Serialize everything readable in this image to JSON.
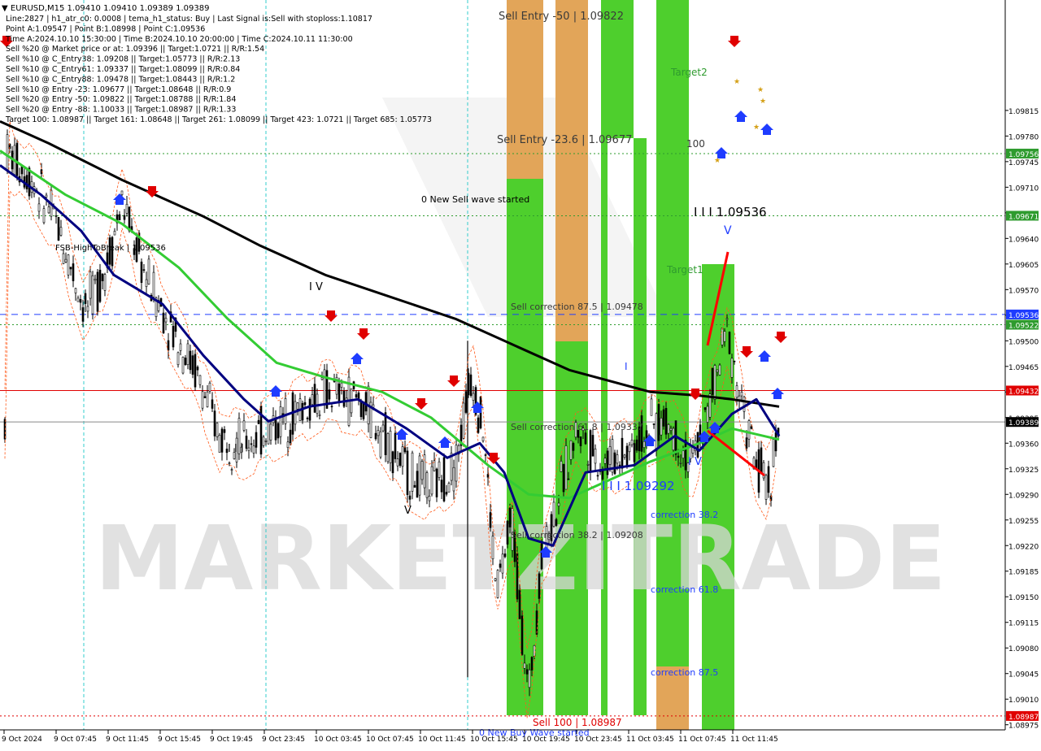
{
  "chart_data": {
    "type": "candlestick",
    "symbol_header": "EURUSD,M15  1.09410 1.09410 1.09389 1.09389",
    "info_lines": [
      "Line:2827 | h1_atr_c0: 0.0008 | tema_h1_status: Buy | Last Signal is:Sell with stoploss:1.10817",
      "Point A:1.09547 | Point B:1.08998 | Point C:1.09536",
      "Time A:2024.10.10 15:30:00 | Time B:2024.10.10 20:00:00 | Time C:2024.10.11 11:30:00",
      "Sell %20 @ Market price or at: 1.09396 || Target:1.0721 || R/R:1.54",
      "Sell %10 @ C_Entry38: 1.09208 || Target:1.05773 || R/R:2.13",
      "Sell %10 @ C_Entry61: 1.09337 || Target:1.08099 || R/R:0.84",
      "Sell %10 @ C_Entry88: 1.09478 || Target:1.08443 || R/R:1.2",
      "Sell %10 @ Entry -23: 1.09677 || Target:1.08648 || R/R:0.9",
      "Sell %20 @ Entry -50: 1.09822 || Target:1.08788 || R/R:1.84",
      "Sell %20 @ Entry -88: 1.10033 || Target:1.08987 || R/R:1.33",
      "Target 100: 1.08987 || Target 161: 1.08648 || Target 261: 1.08099 || Target 423: 1.0721 || Target 685: 1.05773"
    ],
    "y_range": [
      1.08968,
      1.09966
    ],
    "y_ticks": [
      "1.09815",
      "1.09780",
      "1.09745",
      "1.09710",
      "1.09675",
      "1.09640",
      "1.09605",
      "1.09570",
      "1.09535",
      "1.09500",
      "1.09465",
      "1.09430",
      "1.09395",
      "1.09360",
      "1.09325",
      "1.09290",
      "1.09255",
      "1.09220",
      "1.09185",
      "1.09150",
      "1.09115",
      "1.09080",
      "1.09045",
      "1.09010",
      "1.08975"
    ],
    "x_ticks": [
      "9 Oct 2024",
      "9 Oct 07:45",
      "9 Oct 11:45",
      "9 Oct 15:45",
      "9 Oct 19:45",
      "9 Oct 23:45",
      "10 Oct 03:45",
      "10 Oct 07:45",
      "10 Oct 11:45",
      "10 Oct 15:45",
      "10 Oct 19:45",
      "10 Oct 23:45",
      "11 Oct 03:45",
      "11 Oct 07:45",
      "11 Oct 11:45"
    ],
    "price_tags": [
      {
        "value": 1.09756,
        "label": "1.09756",
        "color": "#2e9b2e"
      },
      {
        "value": 1.09671,
        "label": "1.09671",
        "color": "#2e9b2e"
      },
      {
        "value": 1.09536,
        "label": "1.09536",
        "color": "#1e3cff"
      },
      {
        "value": 1.09522,
        "label": "1.09522",
        "color": "#2e9b2e"
      },
      {
        "value": 1.09432,
        "label": "1.09432",
        "color": "#e00000"
      },
      {
        "value": 1.09389,
        "label": "1.09389",
        "color": "#000000"
      },
      {
        "value": 1.08987,
        "label": "1.08987",
        "color": "#e00000"
      }
    ],
    "annotations": [
      {
        "text": "Sell Entry -50 | 1.09822",
        "color": "#3a3a3a"
      },
      {
        "text": "Target2",
        "color": "#2e9b2e"
      },
      {
        "text": "Sell Entry -23.6 | 1.09677",
        "color": "#3a3a3a"
      },
      {
        "text": "100",
        "color": "#3a3a3a"
      },
      {
        "text": "0 New Sell wave started",
        "color": "#000000"
      },
      {
        "text": "I I I 1.09536",
        "color": "#000000"
      },
      {
        "text": "FSB-HighToBreak | 1.09536",
        "color": "#000000"
      },
      {
        "text": "Target1",
        "color": "#2e9b2e"
      },
      {
        "text": "V",
        "color": "#1e3cff"
      },
      {
        "text": "I V",
        "color": "#000000"
      },
      {
        "text": "Sell correction 87.5 | 1.09478",
        "color": "#3a3a3a"
      },
      {
        "text": "I",
        "color": "#1e3cff"
      },
      {
        "text": "Sell correction 61.8 | 1.09337",
        "color": "#3a3a3a"
      },
      {
        "text": "I I I",
        "color": "#000000"
      },
      {
        "text": "I V",
        "color": "#1e3cff"
      },
      {
        "text": "V",
        "color": "#000000"
      },
      {
        "text": "I I I 1.09292",
        "color": "#1e3cff"
      },
      {
        "text": "correction 38.2",
        "color": "#1e3cff"
      },
      {
        "text": "Sell correction 38.2 | 1.09208",
        "color": "#3a3a3a"
      },
      {
        "text": "correction 61.8",
        "color": "#1e3cff"
      },
      {
        "text": "correction 87.5",
        "color": "#1e3cff"
      },
      {
        "text": "Sell 100 | 1.08987",
        "color": "#e00000"
      },
      {
        "text": "0 New Buy Wave started",
        "color": "#1e3cff"
      }
    ],
    "horizontal_levels": [
      {
        "value": 1.09756,
        "style": "dotted",
        "color": "#2e9b2e"
      },
      {
        "value": 1.09671,
        "style": "dotted",
        "color": "#2e9b2e"
      },
      {
        "value": 1.09536,
        "style": "dashed",
        "color": "#1e3cff"
      },
      {
        "value": 1.09522,
        "style": "dotted",
        "color": "#2e9b2e"
      },
      {
        "value": 1.09432,
        "style": "solid",
        "color": "#e00000"
      },
      {
        "value": 1.09389,
        "style": "solid",
        "color": "#888888"
      },
      {
        "value": 1.08987,
        "style": "dotted",
        "color": "#e00000"
      }
    ],
    "vertical_markers": [
      "9 Oct 07:45",
      "9 Oct 23:45",
      "10 Oct 15:45"
    ],
    "series": [
      {
        "kind": "ma",
        "color": "#000000",
        "points": [
          [
            0,
            1.098
          ],
          [
            60,
            1.0977
          ],
          [
            150,
            1.0972
          ],
          [
            250,
            1.0967
          ],
          [
            320,
            1.0963
          ],
          [
            400,
            1.0959
          ],
          [
            480,
            1.0956
          ],
          [
            560,
            1.0953
          ],
          [
            620,
            1.095
          ],
          [
            700,
            1.0946
          ],
          [
            800,
            1.0943
          ],
          [
            860,
            1.09425
          ],
          [
            900,
            1.0942
          ],
          [
            958,
            1.0941
          ]
        ]
      },
      {
        "kind": "ma",
        "color": "#33cc33",
        "points": [
          [
            0,
            1.0976
          ],
          [
            80,
            1.097
          ],
          [
            150,
            1.0966
          ],
          [
            220,
            1.096
          ],
          [
            280,
            1.0953
          ],
          [
            340,
            1.0947
          ],
          [
            400,
            1.0945
          ],
          [
            470,
            1.0943
          ],
          [
            530,
            1.09395
          ],
          [
            600,
            1.0933
          ],
          [
            650,
            1.0929
          ],
          [
            700,
            1.09285
          ],
          [
            750,
            1.0931
          ],
          [
            800,
            1.09335
          ],
          [
            860,
            1.0936
          ],
          [
            900,
            1.0938
          ],
          [
            958,
            1.09365
          ]
        ]
      },
      {
        "kind": "ma",
        "color": "#000080",
        "points": [
          [
            0,
            1.0974
          ],
          [
            50,
            1.097
          ],
          [
            100,
            1.0965
          ],
          [
            140,
            1.0959
          ],
          [
            200,
            1.0955
          ],
          [
            250,
            1.0948
          ],
          [
            300,
            1.0942
          ],
          [
            330,
            1.0939
          ],
          [
            380,
            1.0941
          ],
          [
            440,
            1.0942
          ],
          [
            500,
            1.0938
          ],
          [
            550,
            1.0934
          ],
          [
            590,
            1.0936
          ],
          [
            620,
            1.0932
          ],
          [
            650,
            1.0923
          ],
          [
            680,
            1.0922
          ],
          [
            720,
            1.0932
          ],
          [
            780,
            1.0933
          ],
          [
            830,
            1.0937
          ],
          [
            860,
            1.0935
          ],
          [
            900,
            1.094
          ],
          [
            930,
            1.0942
          ],
          [
            958,
            1.0937
          ]
        ]
      }
    ],
    "zones": [
      {
        "color": "#e0a050",
        "from_x": "10 Oct 15:45",
        "label": "sell entry zone"
      },
      {
        "color": "#44cc22",
        "label": "buy target zone"
      },
      {
        "color": "#e0a050",
        "label": "correction 87.5 zone"
      }
    ],
    "watermark": "MARKETZITRADE"
  }
}
